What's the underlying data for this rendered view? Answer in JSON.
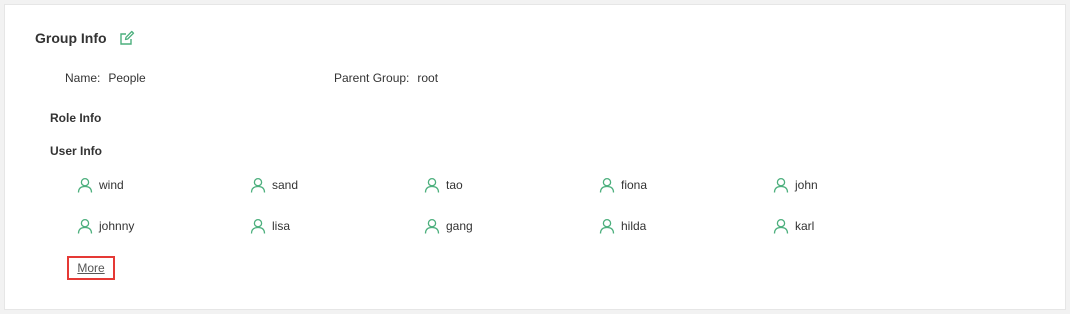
{
  "group_info": {
    "title": "Group Info",
    "edit_icon": "edit-icon",
    "name_label": "Name:",
    "name_value": "People",
    "parent_label": "Parent Group:",
    "parent_value": "root"
  },
  "role_info": {
    "title": "Role Info"
  },
  "user_info": {
    "title": "User Info",
    "icon": "user-icon",
    "users": [
      "wind",
      "sand",
      "tao",
      "fiona",
      "john",
      "johnny",
      "lisa",
      "gang",
      "hilda",
      "karl"
    ],
    "more_label": "More"
  },
  "colors": {
    "accent": "#4caf7d",
    "highlight": "#e53935"
  }
}
